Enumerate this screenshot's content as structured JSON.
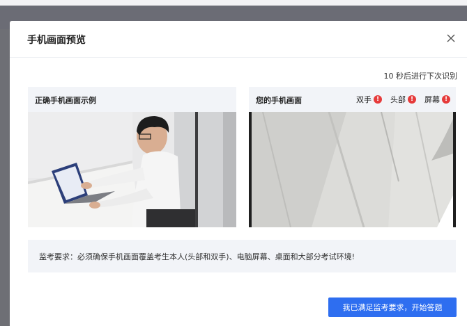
{
  "dialog": {
    "title": "手机画面预览",
    "countdown": "10 秒后进行下次识别"
  },
  "example_panel": {
    "title": "正确手机画面示例"
  },
  "phone_panel": {
    "title": "您的手机画面",
    "status_items": [
      {
        "label": "双手",
        "icon": "alert-icon",
        "color": "#e63b3b"
      },
      {
        "label": "头部",
        "icon": "alert-icon",
        "color": "#e63b3b"
      },
      {
        "label": "屏幕",
        "icon": "alert-icon",
        "color": "#e63b3b"
      }
    ]
  },
  "requirements": {
    "text": "监考要求：必须确保手机画面覆盖考生本人(头部和双手)、电脑屏幕、桌面和大部分考试环境!"
  },
  "actions": {
    "confirm_label": "我已满足监考要求，开始答题",
    "confirm_color": "#2e6ef0"
  }
}
